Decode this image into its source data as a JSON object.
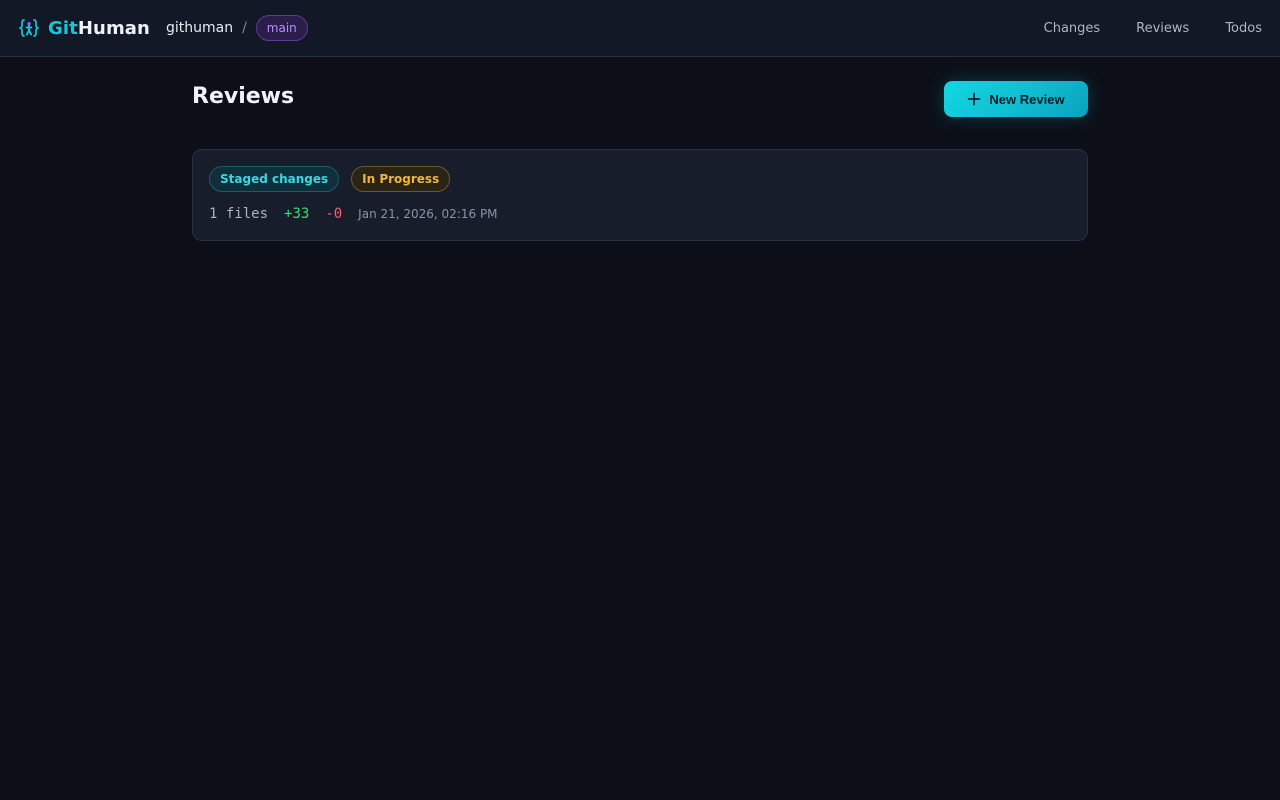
{
  "header": {
    "brand": {
      "git": "Git",
      "human": "Human"
    },
    "repo": "githuman",
    "separator": "/",
    "branch": "main",
    "nav": [
      {
        "label": "Changes"
      },
      {
        "label": "Reviews"
      },
      {
        "label": "Todos"
      }
    ]
  },
  "page": {
    "title": "Reviews",
    "new_review_label": "New Review"
  },
  "reviews": [
    {
      "type_badge": "Staged changes",
      "status_badge": "In Progress",
      "files": "1 files",
      "additions": "+33",
      "deletions": "-0",
      "timestamp": "Jan 21, 2026, 02:16 PM"
    }
  ],
  "colors": {
    "accent": "#19c6d6",
    "branch": "#b691ff",
    "in_progress": "#f1b43a",
    "additions": "#3ddc7a",
    "deletions": "#ff5c77"
  },
  "icons": {
    "logo": "githuman-logo-icon",
    "new_review": "plus-icon"
  }
}
